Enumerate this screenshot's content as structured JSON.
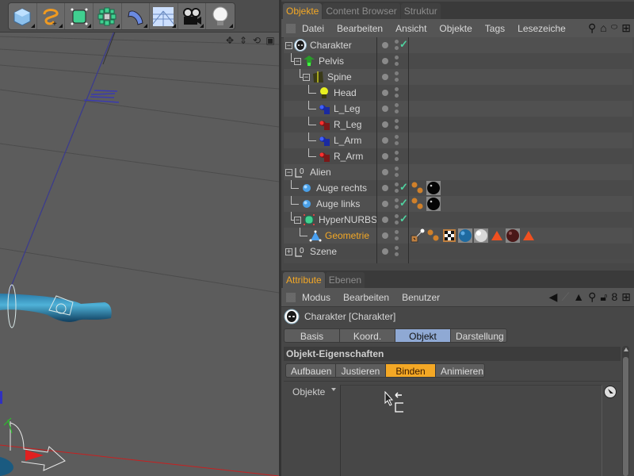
{
  "viewport": {
    "toolbar": [
      {
        "name": "cube-tool",
        "icon": "cube-icon"
      },
      {
        "name": "spline-tool",
        "icon": "spline-icon"
      },
      {
        "name": "nurbs-tool",
        "icon": "nurbs-cube-icon"
      },
      {
        "name": "modeling-tool",
        "icon": "array-icon"
      },
      {
        "name": "deformer-tool",
        "icon": "bend-icon"
      },
      {
        "name": "scene-tool",
        "icon": "floor-icon"
      },
      {
        "name": "camera-tool",
        "icon": "camera-icon"
      },
      {
        "name": "light-tool",
        "icon": "light-bulb-icon"
      }
    ],
    "nav_icons": [
      "move-view-icon",
      "zoom-view-icon",
      "rotate-view-icon",
      "maximize-view-icon"
    ]
  },
  "object_manager": {
    "tabs": [
      {
        "label": "Objekte",
        "active": true
      },
      {
        "label": "Content Browser",
        "active": false
      },
      {
        "label": "Struktur",
        "active": false
      }
    ],
    "menu": [
      "Datei",
      "Bearbeiten",
      "Ansicht",
      "Objekte",
      "Tags",
      "Lesezeiche"
    ],
    "menu_icons": [
      "search-icon",
      "home-icon",
      "ellipse-icon",
      "new-window-icon"
    ],
    "tree": [
      {
        "label": "Charakter",
        "depth": 0,
        "icon": "alien-head-icon",
        "expander": "minus",
        "check": true,
        "tags": []
      },
      {
        "label": "Pelvis",
        "depth": 1,
        "icon": "pelvis-joint-icon",
        "expander": "minus",
        "check": false,
        "tags": []
      },
      {
        "label": "Spine",
        "depth": 2,
        "icon": "spine-icon",
        "expander": "minus",
        "check": false,
        "tags": []
      },
      {
        "label": "Head",
        "depth": 3,
        "icon": "head-icon",
        "expander": null,
        "check": false,
        "tags": []
      },
      {
        "label": "L_Leg",
        "depth": 3,
        "icon": "left-limb-icon",
        "expander": null,
        "check": false,
        "tags": []
      },
      {
        "label": "R_Leg",
        "depth": 3,
        "icon": "right-limb-icon",
        "expander": null,
        "check": false,
        "tags": []
      },
      {
        "label": "L_Arm",
        "depth": 3,
        "icon": "left-limb-icon",
        "expander": null,
        "check": false,
        "tags": []
      },
      {
        "label": "R_Arm",
        "depth": 3,
        "icon": "right-limb-icon",
        "expander": null,
        "check": false,
        "tags": []
      },
      {
        "label": "Alien",
        "depth": 0,
        "icon": "null-object-icon",
        "expander": "minus",
        "check": false,
        "tags": []
      },
      {
        "label": "Auge rechts",
        "depth": 1,
        "icon": "sphere-icon",
        "expander": null,
        "check": true,
        "tags": [
          "phong-tag",
          "black-material"
        ]
      },
      {
        "label": "Auge links",
        "depth": 1,
        "icon": "sphere-icon",
        "expander": null,
        "check": true,
        "tags": [
          "phong-tag",
          "black-material"
        ]
      },
      {
        "label": "HyperNURBS",
        "depth": 1,
        "icon": "hypernurbs-icon",
        "expander": "minus",
        "check": true,
        "tags": []
      },
      {
        "label": "Geometrie",
        "depth": 2,
        "icon": "polygon-object-icon",
        "expander": null,
        "check": false,
        "selected": true,
        "tags": [
          "weight-tag",
          "phong-tag",
          "uvw-tag",
          "blue-material",
          "white-material",
          "selection-tag",
          "dark-red-material",
          "selection-tag"
        ]
      },
      {
        "label": "Szene",
        "depth": 0,
        "icon": "null-object-icon",
        "expander": "plus",
        "check": false,
        "tags": []
      }
    ]
  },
  "attribute_manager": {
    "tabs": [
      {
        "label": "Attribute",
        "active": true
      },
      {
        "label": "Ebenen",
        "active": false
      }
    ],
    "menu": [
      "Modus",
      "Bearbeiten",
      "Benutzer"
    ],
    "menu_icons": [
      "back-arrow-icon",
      "up-arrow-icon",
      "search-icon",
      "lock-icon",
      "link-icon",
      "new-window-icon"
    ],
    "title": "Charakter [Charakter]",
    "main_tabs": [
      {
        "label": "Basis",
        "active": false
      },
      {
        "label": "Koord.",
        "active": false
      },
      {
        "label": "Objekt",
        "active": true
      },
      {
        "label": "Darstellung",
        "active": false
      }
    ],
    "section_title": "Objekt-Eigenschaften",
    "mode_tabs": [
      {
        "label": "Aufbauen",
        "active": false
      },
      {
        "label": "Justieren",
        "active": false
      },
      {
        "label": "Binden",
        "active": true
      },
      {
        "label": "Animieren",
        "active": false
      }
    ],
    "objects_label": "Objekte"
  },
  "colors": {
    "accent_orange": "#f4a825",
    "active_blue": "#8fa9d4",
    "check_green": "#4fd3a0"
  }
}
